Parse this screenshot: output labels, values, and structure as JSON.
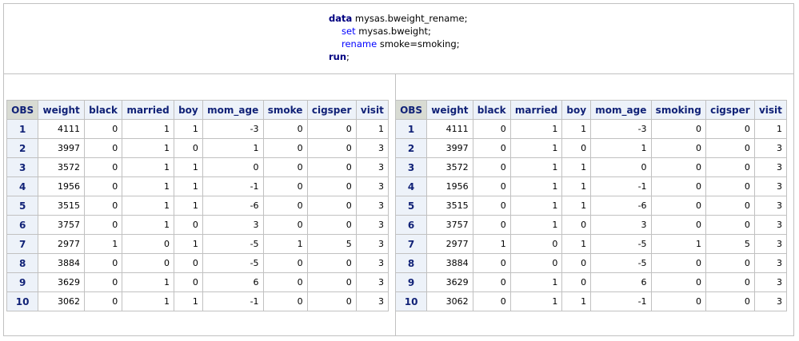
{
  "code": {
    "line1_kw": "data",
    "line1_rest": " mysas.bweight_rename;",
    "line2_kw": "set",
    "line2_rest": " mysas.bweight;",
    "line3_kw": "rename",
    "line3_rest": " smoke=smoking;",
    "line4_kw": "run",
    "line4_rest": ";"
  },
  "left_table": {
    "headers": [
      "OBS",
      "weight",
      "black",
      "married",
      "boy",
      "mom_age",
      "smoke",
      "cigsper",
      "visit"
    ],
    "rows": [
      [
        "1",
        "4111",
        "0",
        "1",
        "1",
        "-3",
        "0",
        "0",
        "1"
      ],
      [
        "2",
        "3997",
        "0",
        "1",
        "0",
        "1",
        "0",
        "0",
        "3"
      ],
      [
        "3",
        "3572",
        "0",
        "1",
        "1",
        "0",
        "0",
        "0",
        "3"
      ],
      [
        "4",
        "1956",
        "0",
        "1",
        "1",
        "-1",
        "0",
        "0",
        "3"
      ],
      [
        "5",
        "3515",
        "0",
        "1",
        "1",
        "-6",
        "0",
        "0",
        "3"
      ],
      [
        "6",
        "3757",
        "0",
        "1",
        "0",
        "3",
        "0",
        "0",
        "3"
      ],
      [
        "7",
        "2977",
        "1",
        "0",
        "1",
        "-5",
        "1",
        "5",
        "3"
      ],
      [
        "8",
        "3884",
        "0",
        "0",
        "0",
        "-5",
        "0",
        "0",
        "3"
      ],
      [
        "9",
        "3629",
        "0",
        "1",
        "0",
        "6",
        "0",
        "0",
        "3"
      ],
      [
        "10",
        "3062",
        "0",
        "1",
        "1",
        "-1",
        "0",
        "0",
        "3"
      ]
    ]
  },
  "right_table": {
    "headers": [
      "OBS",
      "weight",
      "black",
      "married",
      "boy",
      "mom_age",
      "smoking",
      "cigsper",
      "visit"
    ],
    "rows": [
      [
        "1",
        "4111",
        "0",
        "1",
        "1",
        "-3",
        "0",
        "0",
        "1"
      ],
      [
        "2",
        "3997",
        "0",
        "1",
        "0",
        "1",
        "0",
        "0",
        "3"
      ],
      [
        "3",
        "3572",
        "0",
        "1",
        "1",
        "0",
        "0",
        "0",
        "3"
      ],
      [
        "4",
        "1956",
        "0",
        "1",
        "1",
        "-1",
        "0",
        "0",
        "3"
      ],
      [
        "5",
        "3515",
        "0",
        "1",
        "1",
        "-6",
        "0",
        "0",
        "3"
      ],
      [
        "6",
        "3757",
        "0",
        "1",
        "0",
        "3",
        "0",
        "0",
        "3"
      ],
      [
        "7",
        "2977",
        "1",
        "0",
        "1",
        "-5",
        "1",
        "5",
        "3"
      ],
      [
        "8",
        "3884",
        "0",
        "0",
        "0",
        "-5",
        "0",
        "0",
        "3"
      ],
      [
        "9",
        "3629",
        "0",
        "1",
        "0",
        "6",
        "0",
        "0",
        "3"
      ],
      [
        "10",
        "3062",
        "0",
        "1",
        "1",
        "-1",
        "0",
        "0",
        "3"
      ]
    ]
  }
}
